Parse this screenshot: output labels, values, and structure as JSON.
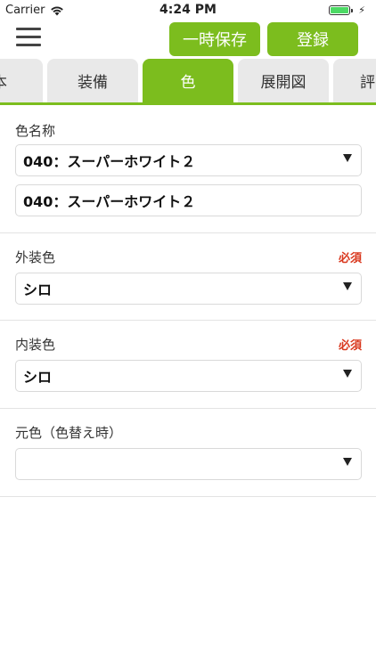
{
  "status_bar": {
    "carrier": "Carrier",
    "time": "4:24 PM",
    "battery_level": 1.0,
    "battery_color": "#4cd964",
    "icons": [
      "wifi-icon",
      "battery-icon",
      "charging-icon"
    ]
  },
  "nav": {
    "menu_icon": "hamburger-menu-icon",
    "temp_save_label": "一時保存",
    "register_label": "登録",
    "accent_color": "#7cbd1e"
  },
  "tabs": [
    {
      "label": "本",
      "active": false
    },
    {
      "label": "装備",
      "active": false
    },
    {
      "label": "色",
      "active": true
    },
    {
      "label": "展開図",
      "active": false
    },
    {
      "label": "評",
      "active": false
    }
  ],
  "form": {
    "color_name": {
      "label": "色名称",
      "selected": "040：スーパーホワイト２",
      "text_value": "040：スーパーホワイト２"
    },
    "exterior_color": {
      "label": "外装色",
      "required_label": "必須",
      "selected": "シロ"
    },
    "interior_color": {
      "label": "内装色",
      "required_label": "必須",
      "selected": "シロ"
    },
    "original_color": {
      "label": "元色（色替え時）",
      "selected": ""
    },
    "required_color": "#d9381e"
  }
}
